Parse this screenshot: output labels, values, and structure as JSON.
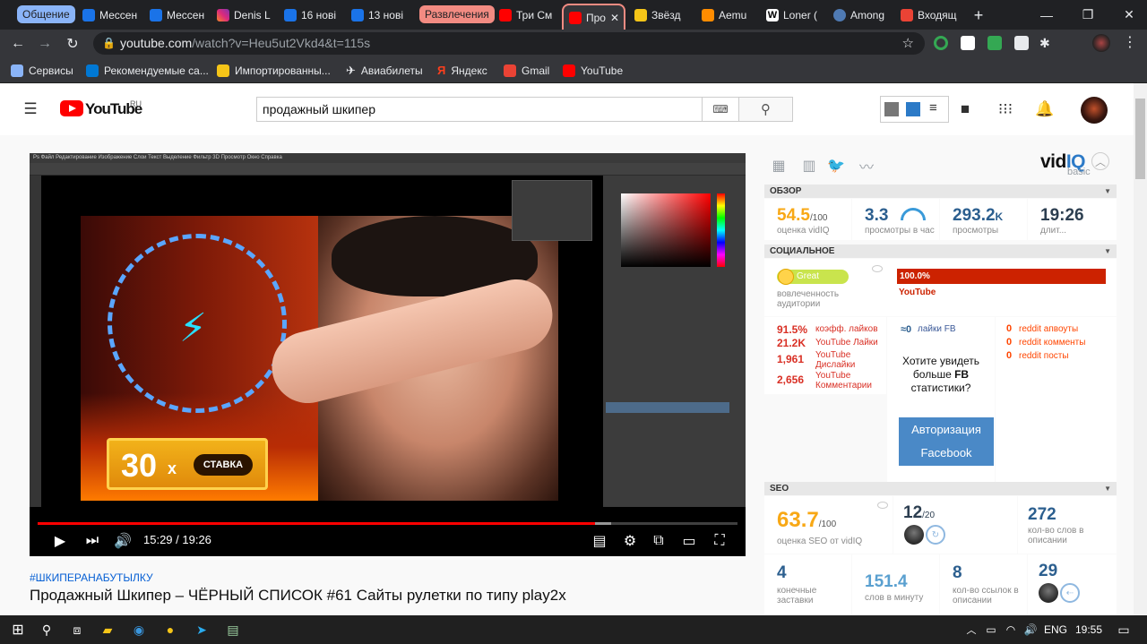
{
  "browser": {
    "tab_groups": [
      {
        "label": "Общение",
        "color": "#8ab4f8"
      },
      {
        "label": "Развлечения",
        "color": "#f28b82"
      }
    ],
    "tabs": [
      {
        "label": "Мессен",
        "icon": "message-icon",
        "color": "#1a73e8"
      },
      {
        "label": "Мессен",
        "icon": "message-icon",
        "color": "#1a73e8"
      },
      {
        "label": "Denis L",
        "icon": "instagram-icon",
        "color": "#c13584"
      },
      {
        "label": "16 нові",
        "icon": "plus-icon",
        "color": "#1a73e8"
      },
      {
        "label": "13 нові",
        "icon": "message-icon",
        "color": "#1a73e8"
      },
      {
        "label": "Три См",
        "icon": "youtube-icon",
        "color": "#ff0000"
      },
      {
        "label": "Про",
        "icon": "youtube-icon",
        "color": "#ff0000"
      },
      {
        "label": "Звёзд",
        "icon": "star-icon",
        "color": "#f5c518"
      },
      {
        "label": "Aemu",
        "icon": "og-icon",
        "color": "#ff8c00"
      },
      {
        "label": "Loner (",
        "icon": "wikipedia-icon",
        "color": "#ffffff"
      },
      {
        "label": "Among",
        "icon": "steam-icon",
        "color": "#4f7ab3"
      },
      {
        "label": "Входящ",
        "icon": "gmail-icon",
        "color": "#ea4335"
      }
    ],
    "new_tab": "+",
    "url_domain": "youtube.com",
    "url_path": "/watch?v=Heu5ut2Vkd4&t=115s",
    "bookmarks": [
      {
        "label": "Сервисы",
        "icon": "apps-grid-icon",
        "color": "#8ab4f8"
      },
      {
        "label": "Рекомендуемые са...",
        "icon": "bing-icon",
        "color": "#0078d4"
      },
      {
        "label": "Импортированны...",
        "icon": "folder-icon",
        "color": "#f5c518"
      },
      {
        "label": "Авиабилеты",
        "icon": "plane-icon",
        "color": "#e8eaed"
      },
      {
        "label": "Яндекс",
        "icon": "yandex-icon",
        "color": "#fc3f1d"
      },
      {
        "label": "Gmail",
        "icon": "gmail-icon",
        "color": "#ea4335"
      },
      {
        "label": "YouTube",
        "icon": "youtube-icon",
        "color": "#ff0000"
      }
    ]
  },
  "youtube": {
    "logo_text": "YouTube",
    "logo_region": "RU",
    "search_value": "продажный шкипер",
    "video": {
      "time": "15:29 / 19:26",
      "progress": 0.796,
      "bet_number": "30",
      "bet_x": "x",
      "bet_label": "СТАВКА",
      "ps_menu": "Ps   Файл   Редактирование   Изображение   Слои   Текст   Выделение   Фильтр   3D   Просмотр   Окно   Справка"
    },
    "hashtag": "#ШКИПЕРАНАБУТЫЛКУ",
    "title": "Продажный Шкипер – ЧЁРНЫЙ СПИСОК #61 Сайты рулетки по типу play2x"
  },
  "vidiq": {
    "logo_vid": "vid",
    "logo_iq": "IQ",
    "logo_basic": "basic",
    "sections": {
      "overview": "ОБЗОР",
      "social": "СОЦИАЛЬНОЕ",
      "seo": "SEO"
    },
    "overview": [
      {
        "value": "54.5",
        "suffix": "/100",
        "label": "оценка vidIQ"
      },
      {
        "value": "3.3",
        "suffix": "",
        "label": "просмотры в час"
      },
      {
        "value": "293.2",
        "suffix": "K",
        "label": "просмотры"
      },
      {
        "value": "19:26",
        "suffix": "",
        "label": "длит..."
      }
    ],
    "social": {
      "engagement_badge": "Great",
      "engagement_label": "вовлеченность аудитории",
      "youtube_share": "100.0%",
      "youtube_share_label": "YouTube",
      "stats": [
        {
          "value": "91.5%",
          "label": "коэфф. лайков"
        },
        {
          "value": "21.2K",
          "label": "YouTube Лайки"
        },
        {
          "value": "1,961",
          "label": "YouTube Дислайки"
        },
        {
          "value": "2,656",
          "label": "YouTube Комментарии"
        }
      ],
      "fb_likes_value": "≈0",
      "fb_likes_label": "лайки FB",
      "fb_prompt_1": "Хотите увидеть больше ",
      "fb_prompt_bold": "FB",
      "fb_prompt_2": " статистики?",
      "fb_button_1": "Авторизация",
      "fb_button_2": "Facebook",
      "reddit": [
        {
          "value": "0",
          "label": "reddit апвоуты"
        },
        {
          "value": "0",
          "label": "reddit комменты"
        },
        {
          "value": "0",
          "label": "reddit посты"
        }
      ]
    },
    "seo": {
      "score": "63.7",
      "score_suffix": "/100",
      "score_label": "оценка SEO от vidIQ",
      "tags_value": "12",
      "tags_suffix": "/20",
      "desc_words": "272",
      "desc_words_label": "кол-во слов в описании",
      "end_screens": "4",
      "end_screens_label": "конечные заставки",
      "wpm": "151.4",
      "wpm_label": "слов в минуту",
      "links": "8",
      "links_label": "кол-во ссылок в описании",
      "subs_value": "29"
    }
  },
  "taskbar": {
    "lang": "ENG",
    "time": "19:55"
  }
}
